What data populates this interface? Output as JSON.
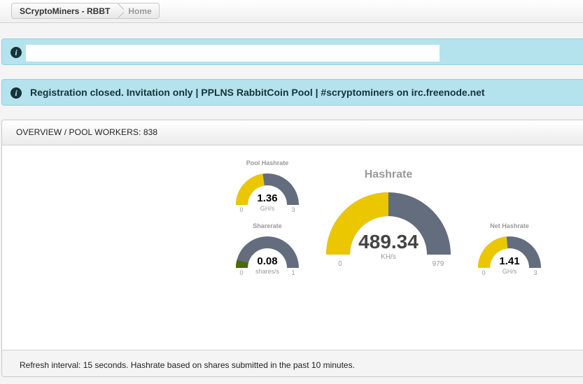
{
  "breadcrumb": {
    "items": [
      "SCryptoMiners - RBBT",
      "Home"
    ]
  },
  "alerts": {
    "first_text": "",
    "second_text": "Registration closed. Invitation only | PPLNS RabbitCoin Pool | #scryptominers on irc.freenode.net"
  },
  "panel": {
    "title": "OVERVIEW / POOL WORKERS: 838",
    "footer": "Refresh interval: 15 seconds. Hashrate based on shares submitted in the past 10 minutes."
  },
  "gauges": {
    "pool_hashrate": {
      "title": "Pool Hashrate",
      "value": "1.36",
      "unit": "GH/s",
      "min": "0",
      "max": "3",
      "fraction": 0.4533,
      "color": "#eac700"
    },
    "sharerate": {
      "title": "Sharerate",
      "value": "0.08",
      "unit": "shares/s",
      "min": "0",
      "max": "1",
      "fraction": 0.08,
      "color": "#4b6a04"
    },
    "hashrate": {
      "title": "Hashrate",
      "value": "489.34",
      "unit": "KH/s",
      "min": "0",
      "max": "979",
      "fraction": 0.4998,
      "color": "#eac700"
    },
    "net_hashrate": {
      "title": "Net Hashrate",
      "value": "1.41",
      "unit": "GH/s",
      "min": "0",
      "max": "3",
      "fraction": 0.47,
      "color": "#eac700"
    }
  },
  "colors": {
    "gauge_track": "#636d7d",
    "alert_bg": "#b4e3ed",
    "alert_text": "#16333c"
  }
}
